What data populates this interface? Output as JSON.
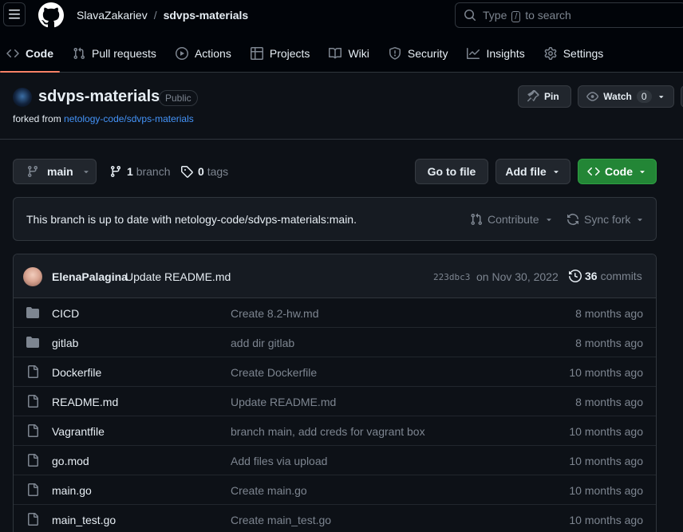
{
  "header": {
    "owner": "SlavaZakariev",
    "separator": "/",
    "repo": "sdvps-materials",
    "search_prefix": "Type",
    "search_key": "/",
    "search_suffix": "to search"
  },
  "tabs": [
    {
      "label": "Code",
      "icon": "code-icon"
    },
    {
      "label": "Pull requests",
      "icon": "pull-request-icon"
    },
    {
      "label": "Actions",
      "icon": "play-icon"
    },
    {
      "label": "Projects",
      "icon": "table-icon"
    },
    {
      "label": "Wiki",
      "icon": "book-icon"
    },
    {
      "label": "Security",
      "icon": "shield-icon"
    },
    {
      "label": "Insights",
      "icon": "graph-icon"
    },
    {
      "label": "Settings",
      "icon": "gear-icon"
    }
  ],
  "repo": {
    "name": "sdvps-materials",
    "visibility": "Public",
    "forked_prefix": "forked from",
    "forked_source": "netology-code/sdvps-materials",
    "pin_label": "Pin",
    "watch_label": "Watch",
    "watch_count": "0"
  },
  "branch_bar": {
    "branch": "main",
    "branch_count": "1",
    "branch_word": "branch",
    "tag_count": "0",
    "tag_word": "tags",
    "goto_file": "Go to file",
    "add_file": "Add file",
    "code": "Code"
  },
  "status": {
    "text": "This branch is up to date with netology-code/sdvps-materials:main.",
    "contribute": "Contribute",
    "sync_fork": "Sync fork"
  },
  "latest_commit": {
    "author": "ElenaPalagina",
    "message": "Update README.md",
    "sha": "223dbc3",
    "date": "on Nov 30, 2022",
    "commit_count": "36",
    "commit_word": "commits"
  },
  "files": [
    {
      "type": "folder",
      "name": "CICD",
      "message": "Create 8.2-hw.md",
      "age": "8 months ago"
    },
    {
      "type": "folder",
      "name": "gitlab",
      "message": "add dir gitlab",
      "age": "8 months ago"
    },
    {
      "type": "file",
      "name": "Dockerfile",
      "message": "Create Dockerfile",
      "age": "10 months ago"
    },
    {
      "type": "file",
      "name": "README.md",
      "message": "Update README.md",
      "age": "8 months ago"
    },
    {
      "type": "file",
      "name": "Vagrantfile",
      "message": "branch main, add creds for vagrant box",
      "age": "10 months ago"
    },
    {
      "type": "file",
      "name": "go.mod",
      "message": "Add files via upload",
      "age": "10 months ago"
    },
    {
      "type": "file",
      "name": "main.go",
      "message": "Create main.go",
      "age": "10 months ago"
    },
    {
      "type": "file",
      "name": "main_test.go",
      "message": "Create main_test.go",
      "age": "10 months ago"
    }
  ],
  "colors": {
    "background": "#0d1117",
    "header": "#010409",
    "accent_tab": "#f78166",
    "link": "#4493f8",
    "code_button": "#238636",
    "folder_icon": "#7d8590"
  }
}
